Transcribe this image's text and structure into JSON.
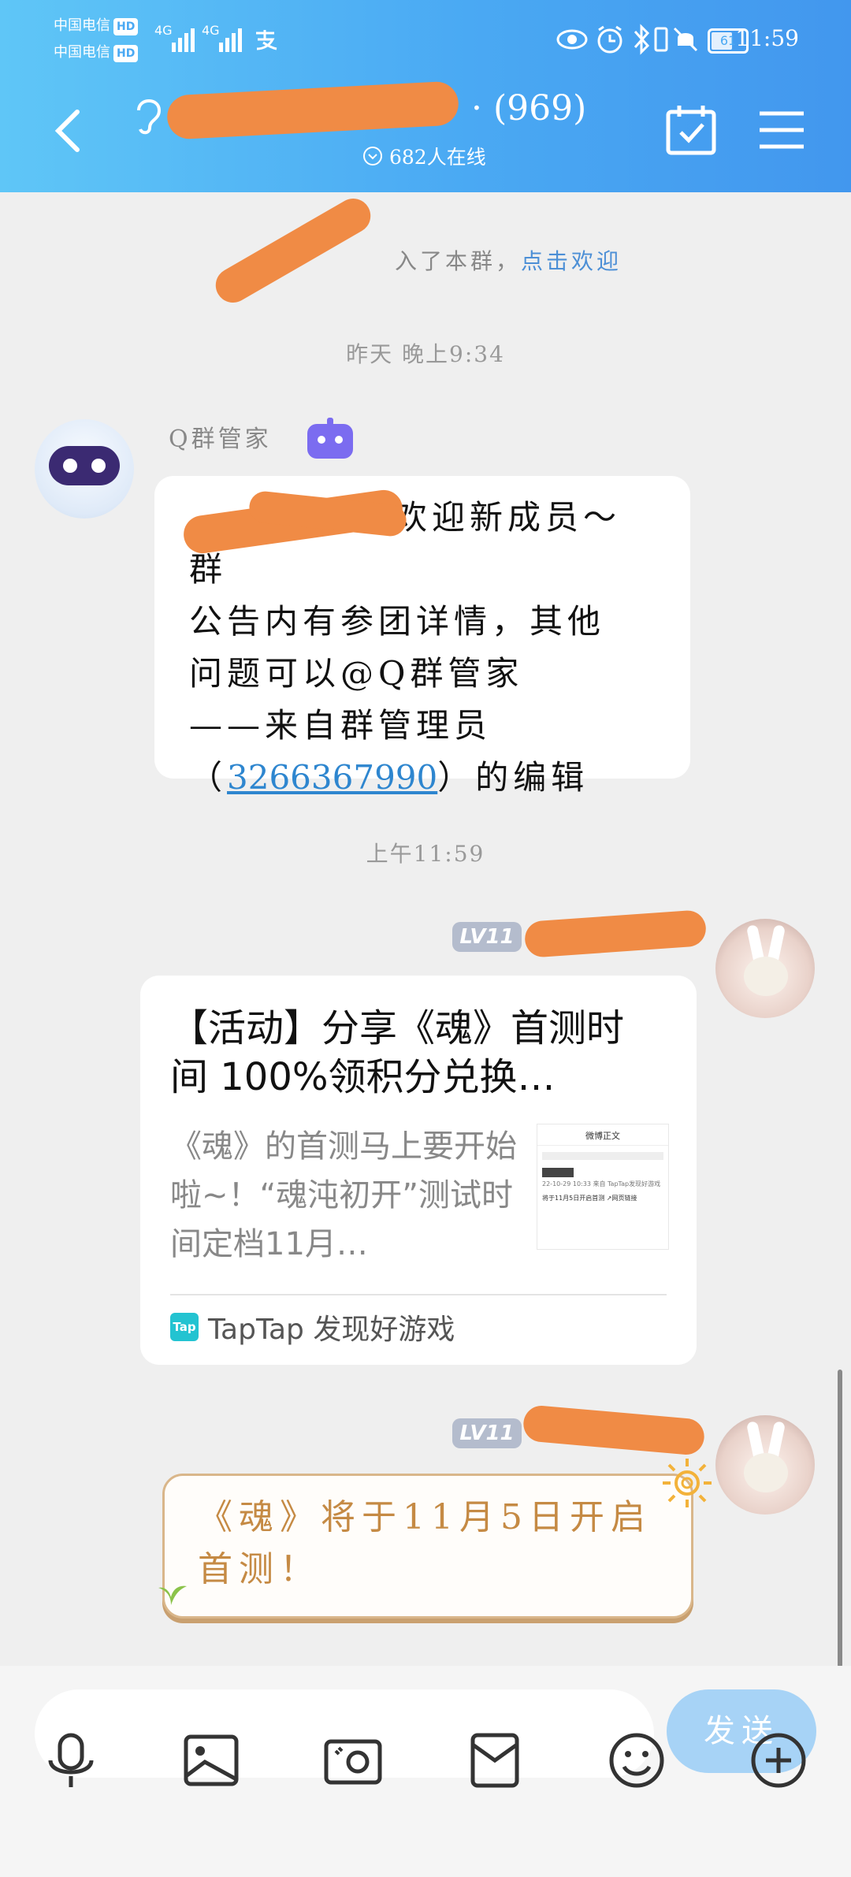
{
  "status_bar": {
    "carrier_1": "中国电信",
    "carrier_2": "中国电信",
    "hd": "HD",
    "network": "4G",
    "battery": "61",
    "time": "11:59"
  },
  "nav": {
    "member_count": "· (969)",
    "online": "682人在线"
  },
  "system_message": {
    "text": "入了本群，",
    "link": "点击欢迎"
  },
  "timestamps": [
    "昨天 晚上9:34",
    "上午11:59"
  ],
  "bot": {
    "name": "Q群管家",
    "message_line_1": "欢迎新成员～群",
    "message_line_2": "公告内有参团详情，其他",
    "message_line_3": "问题可以@Q群管家",
    "message_line_4": "——来自群管理员",
    "qq_open": "（",
    "qq_number": "3266367990",
    "qq_close": "）的编辑"
  },
  "messages": [
    {
      "level": "LV11",
      "card": {
        "title": "【活动】分享《魂》首测时间 100%领积分兑换…",
        "description": "《魂》的首测马上要开始啦~！“魂沌初开”测试时间定档11月…",
        "thumb_header": "微博正文",
        "thumb_line": "22-10-29 10:33 来自 TapTap发现好游戏",
        "thumb_link": "将于11月5日开启首测 ↗网页链接",
        "source_logo": "Tap",
        "source": "TapTap 发现好游戏"
      }
    },
    {
      "level": "LV11",
      "text": "《魂》将于11月5日开启首测！"
    }
  ],
  "input": {
    "send": "发送"
  },
  "colors": {
    "header_start": "#5fc6f7",
    "header_end": "#4297ee",
    "redaction": "#f08b45",
    "link": "#2e86cf"
  }
}
